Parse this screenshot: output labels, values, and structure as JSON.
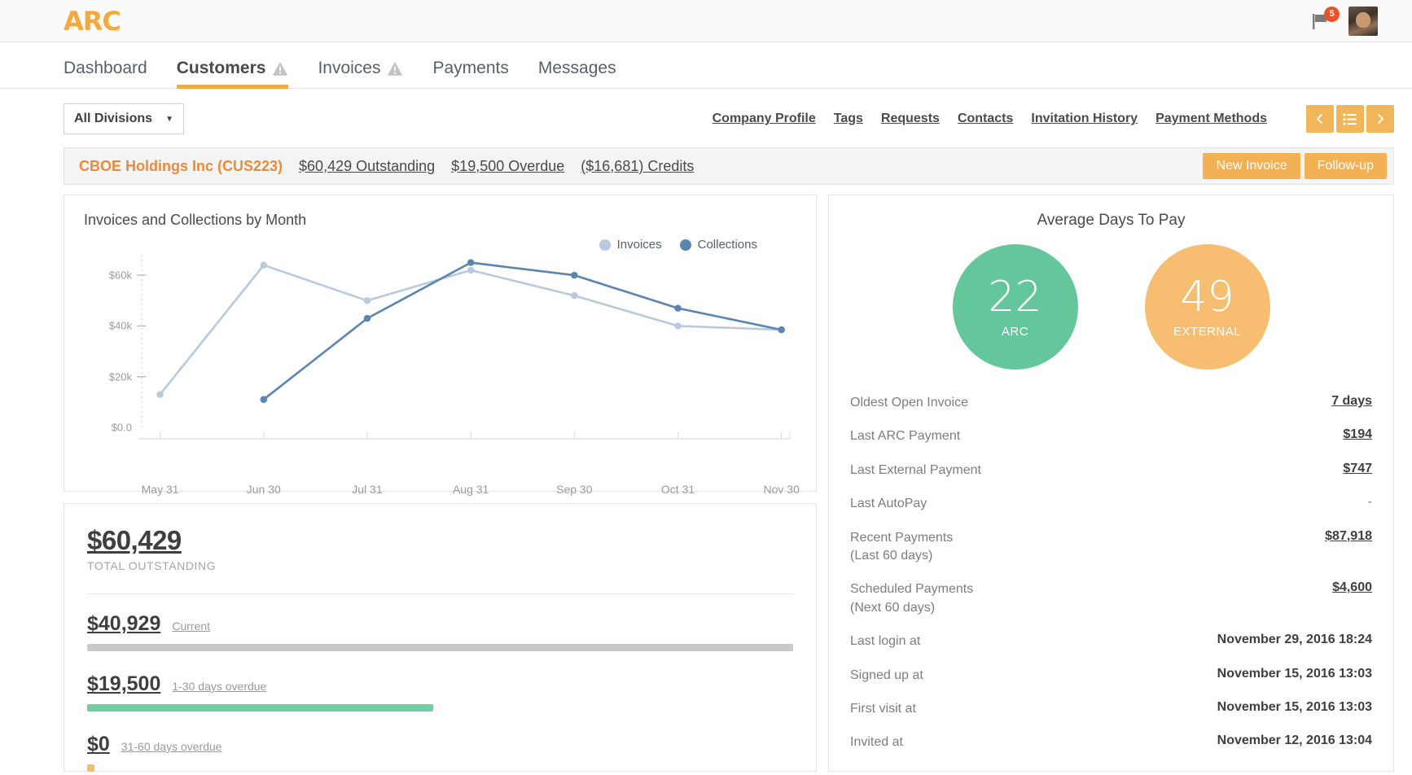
{
  "header": {
    "logo_text": "ARC",
    "flag_icon": "flag-icon",
    "flag_badge_count": "5",
    "avatar_name": "user-avatar"
  },
  "nav": {
    "tabs": [
      {
        "label": "Dashboard",
        "warn": false,
        "active": false
      },
      {
        "label": "Customers",
        "warn": true,
        "active": true
      },
      {
        "label": "Invoices",
        "warn": true,
        "active": false
      },
      {
        "label": "Payments",
        "warn": false,
        "active": false
      },
      {
        "label": "Messages",
        "warn": false,
        "active": false
      }
    ]
  },
  "subheader": {
    "divisions_value": "All Divisions",
    "caret_icon": "chevron-down-icon",
    "links": [
      "Company Profile",
      "Tags",
      "Requests",
      "Contacts",
      "Invitation History",
      "Payment Methods"
    ],
    "pager": {
      "prev_icon": "chevron-left-icon",
      "list_icon": "list-icon",
      "next_icon": "chevron-right-icon"
    }
  },
  "customer_banner": {
    "name": "CBOE Holdings Inc (CUS223)",
    "stats": [
      "$60,429 Outstanding",
      "$19,500 Overdue",
      "($16,681) Credits"
    ],
    "new_invoice_label": "New Invoice",
    "followup_label": "Follow-up"
  },
  "chart_card": {
    "title": "Invoices and Collections by Month"
  },
  "chart_data": {
    "type": "line",
    "title": "Invoices and Collections by Month",
    "xlabel": "",
    "ylabel": "",
    "ylim": [
      0,
      70000
    ],
    "grid": false,
    "legend_position": "top-right",
    "ytick_labels": [
      "$0.0",
      "$20k",
      "$40k",
      "$60k"
    ],
    "ytick_values": [
      0,
      20000,
      40000,
      60000
    ],
    "categories": [
      "May 31",
      "Jun 30",
      "Jul 31",
      "Aug 31",
      "Sep 30",
      "Oct 31",
      "Nov 30"
    ],
    "series": [
      {
        "name": "Invoices",
        "color": "#b9c9de",
        "values": [
          13000,
          64000,
          50000,
          62000,
          52000,
          40000,
          38500
        ]
      },
      {
        "name": "Collections",
        "color": "#5b85b0",
        "values": [
          null,
          11000,
          43000,
          65000,
          60000,
          47000,
          38500
        ]
      }
    ]
  },
  "outstanding": {
    "total_amount": "$60,429",
    "total_label": "TOTAL OUTSTANDING",
    "buckets": [
      {
        "amount": "$40,929",
        "desc": "Current",
        "pct": 100,
        "color": "#c9c9c9"
      },
      {
        "amount": "$19,500",
        "desc": "1-30 days overdue",
        "pct": 49,
        "color": "#6ecf9f"
      },
      {
        "amount": "$0",
        "desc": "31-60 days overdue",
        "pct": 1,
        "color": "#f5bc6a"
      }
    ]
  },
  "days_to_pay": {
    "title": "Average Days To Pay",
    "circles": [
      {
        "value": "22",
        "label": "ARC",
        "color": "#64c79c"
      },
      {
        "value": "49",
        "label": "EXTERNAL",
        "color": "#f7bd70"
      }
    ],
    "rows": [
      {
        "key": "Oldest Open Invoice",
        "sub": "",
        "value": "7 days",
        "style": "link"
      },
      {
        "key": "Last ARC Payment",
        "sub": "",
        "value": "$194",
        "style": "link"
      },
      {
        "key": "Last External Payment",
        "sub": "",
        "value": "$747",
        "style": "link"
      },
      {
        "key": "Last AutoPay",
        "sub": "",
        "value": "-",
        "style": "dash"
      },
      {
        "key": "Recent Payments",
        "sub": "(Last 60 days)",
        "value": "$87,918",
        "style": "link"
      },
      {
        "key": "Scheduled Payments",
        "sub": "(Next 60 days)",
        "value": "$4,600",
        "style": "link"
      },
      {
        "key": "Last login at",
        "sub": "",
        "value": "November 29, 2016 18:24",
        "style": "plain"
      },
      {
        "key": "Signed up at",
        "sub": "",
        "value": "November 15, 2016 13:03",
        "style": "plain"
      },
      {
        "key": "First visit at",
        "sub": "",
        "value": "November 15, 2016 13:03",
        "style": "plain"
      },
      {
        "key": "Invited at",
        "sub": "",
        "value": "November 12, 2016 13:04",
        "style": "plain"
      }
    ]
  },
  "colors": {
    "accent_orange": "#f5a83c",
    "banner_orange": "#e98b3a",
    "green": "#64c79c",
    "blue_dark": "#5b85b0",
    "blue_light": "#b9c9de"
  }
}
